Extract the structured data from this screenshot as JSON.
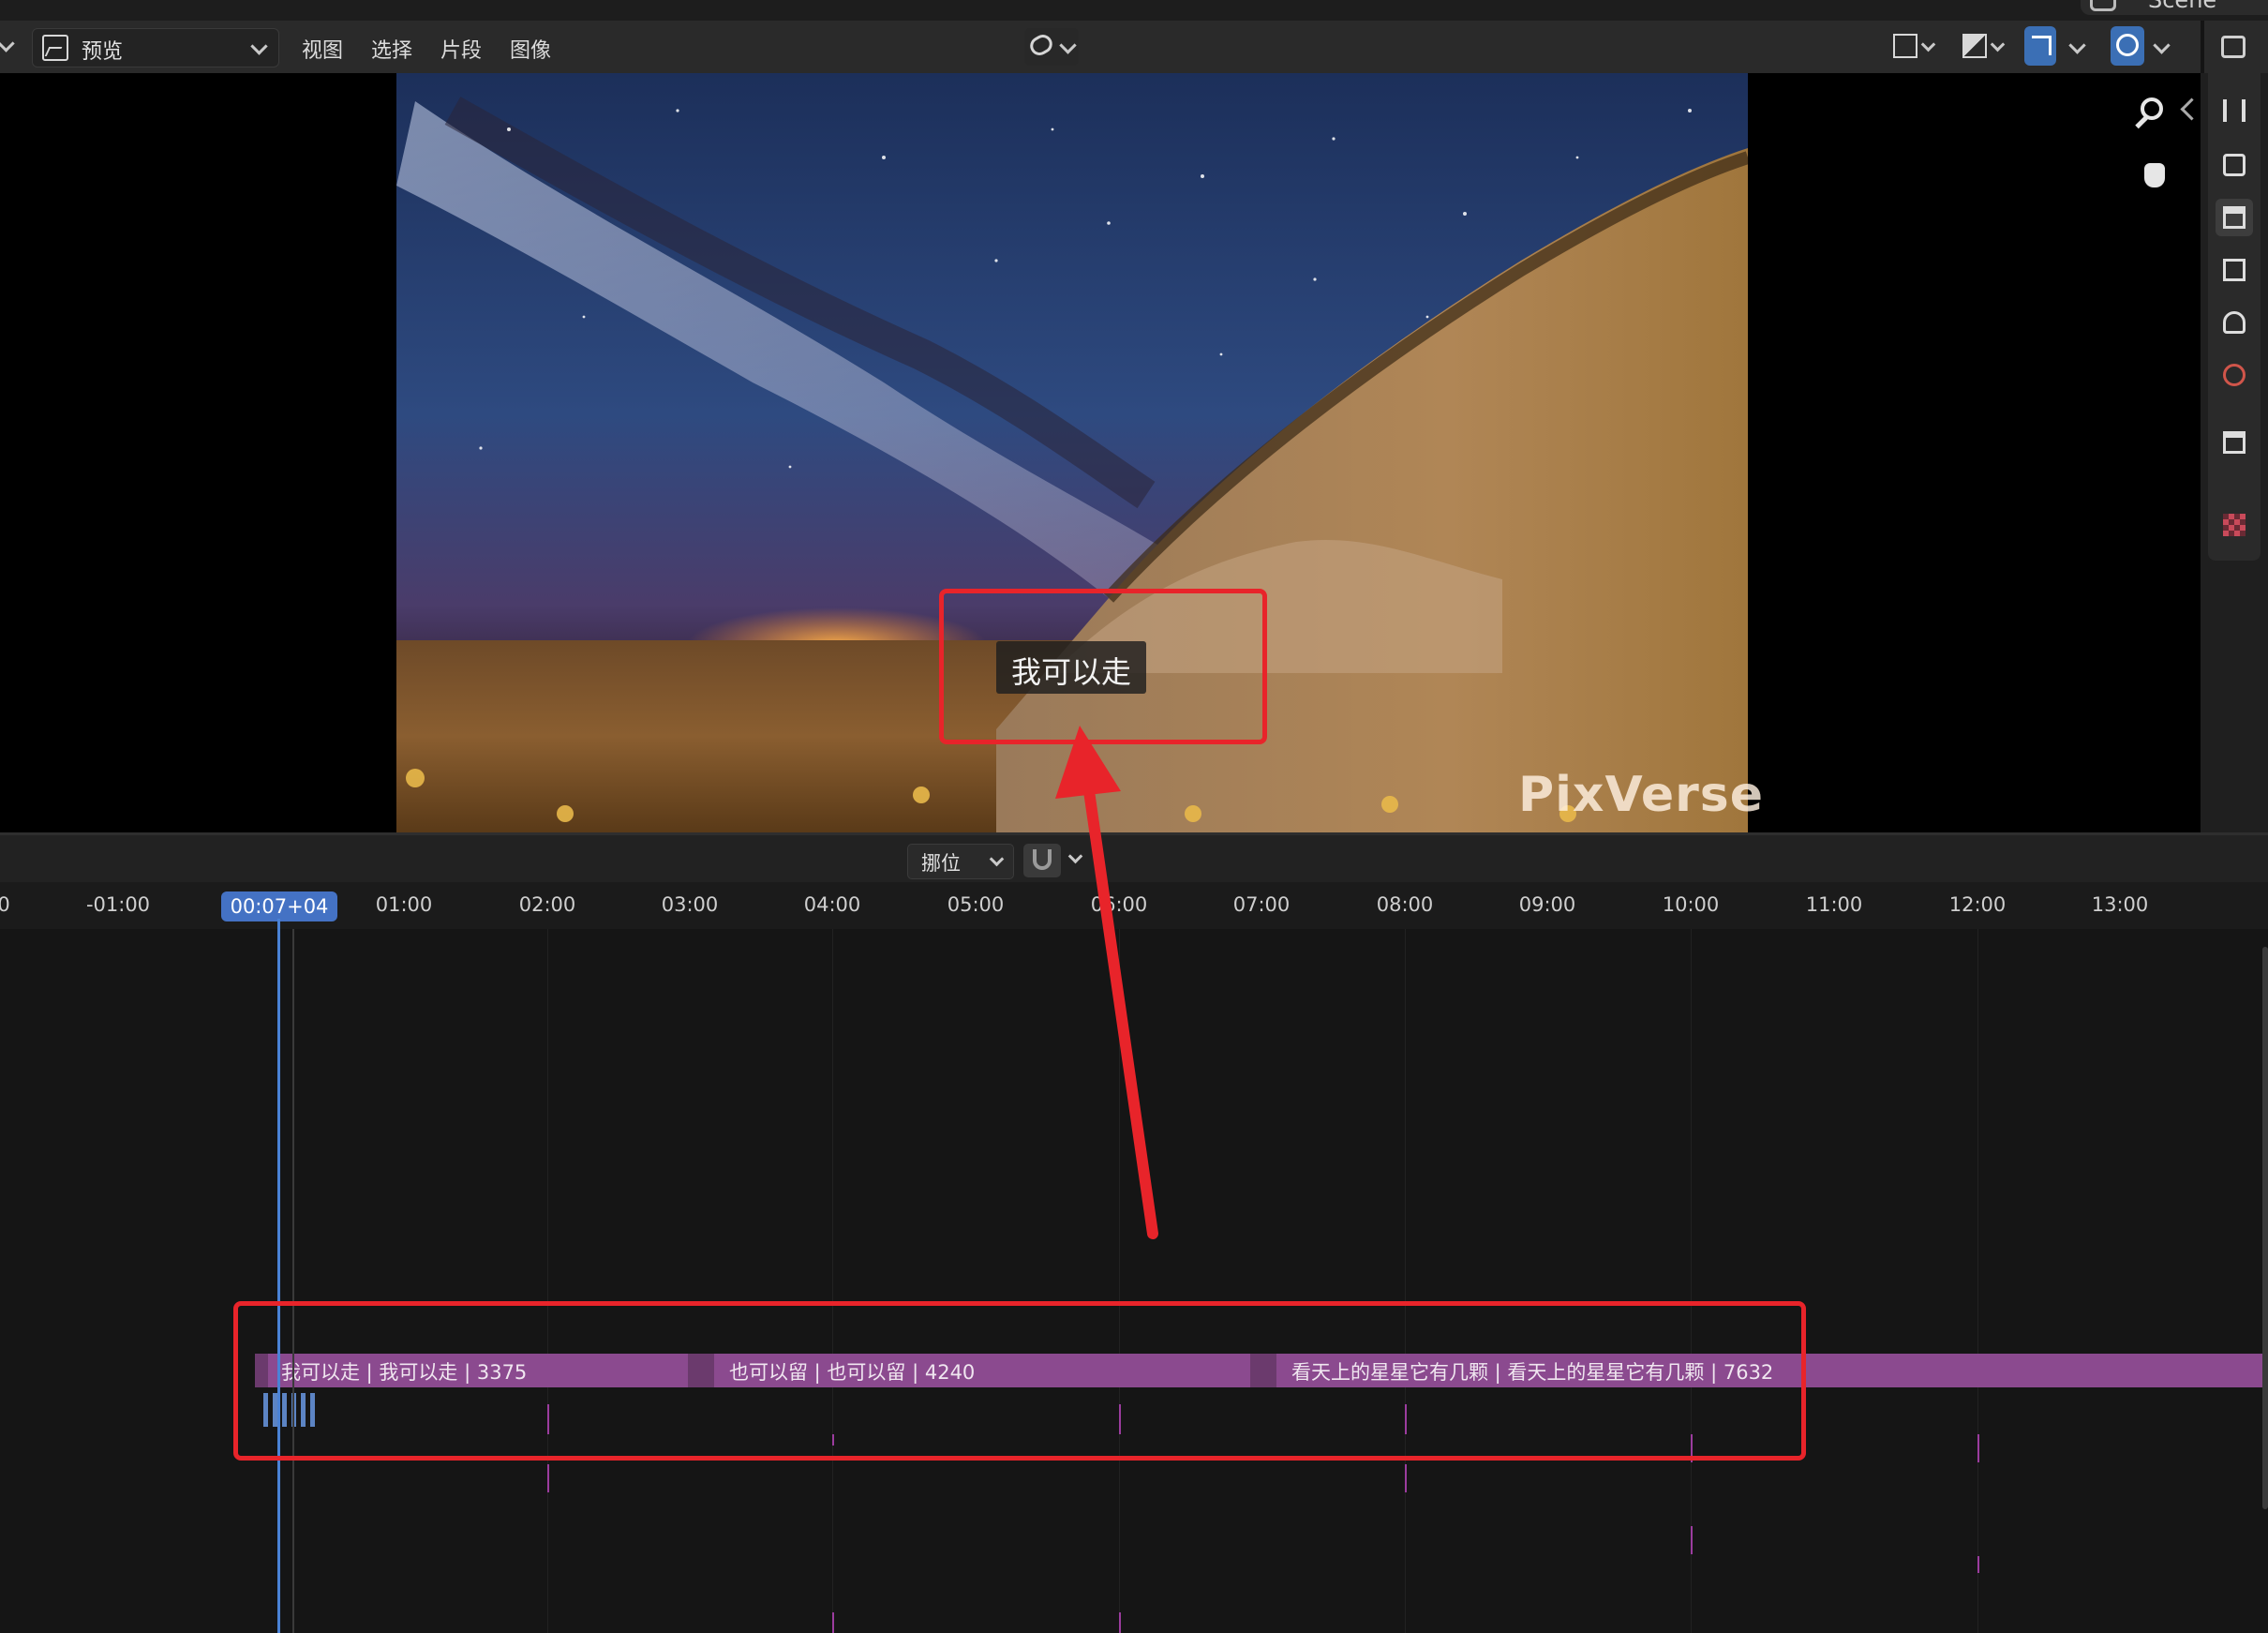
{
  "window": {
    "scene_label": "Scene"
  },
  "header": {
    "mode_label": "预览",
    "menus": [
      "视图",
      "选择",
      "片段",
      "图像"
    ]
  },
  "preview": {
    "subtitle": "我可以走",
    "watermark": "PixVerse"
  },
  "timeline": {
    "snap_label": "挪位",
    "playhead_time": "00:07+04",
    "ruler_labels": [
      "0",
      "-01:00",
      "01:00",
      "02:00",
      "03:00",
      "04:00",
      "05:00",
      "06:00",
      "07:00",
      "08:00",
      "09:00",
      "10:00",
      "11:00",
      "12:00",
      "13:00"
    ],
    "strips": [
      {
        "label": "我可以走 | 我可以走 | 3375"
      },
      {
        "label": "也可以留 | 也可以留 | 4240"
      },
      {
        "label": "看天上的星星它有几颗 | 看天上的星星它有几颗 | 7632"
      }
    ]
  },
  "icons": {
    "mode": "image-preview-icon",
    "link": "link-icon",
    "zoom": "zoom-in-icon",
    "pan": "hand-pan-icon",
    "snap": "magnet-icon"
  },
  "colors": {
    "accent": "#4472c4",
    "strip": "#8b4a8f",
    "annotation": "#e8242a"
  }
}
